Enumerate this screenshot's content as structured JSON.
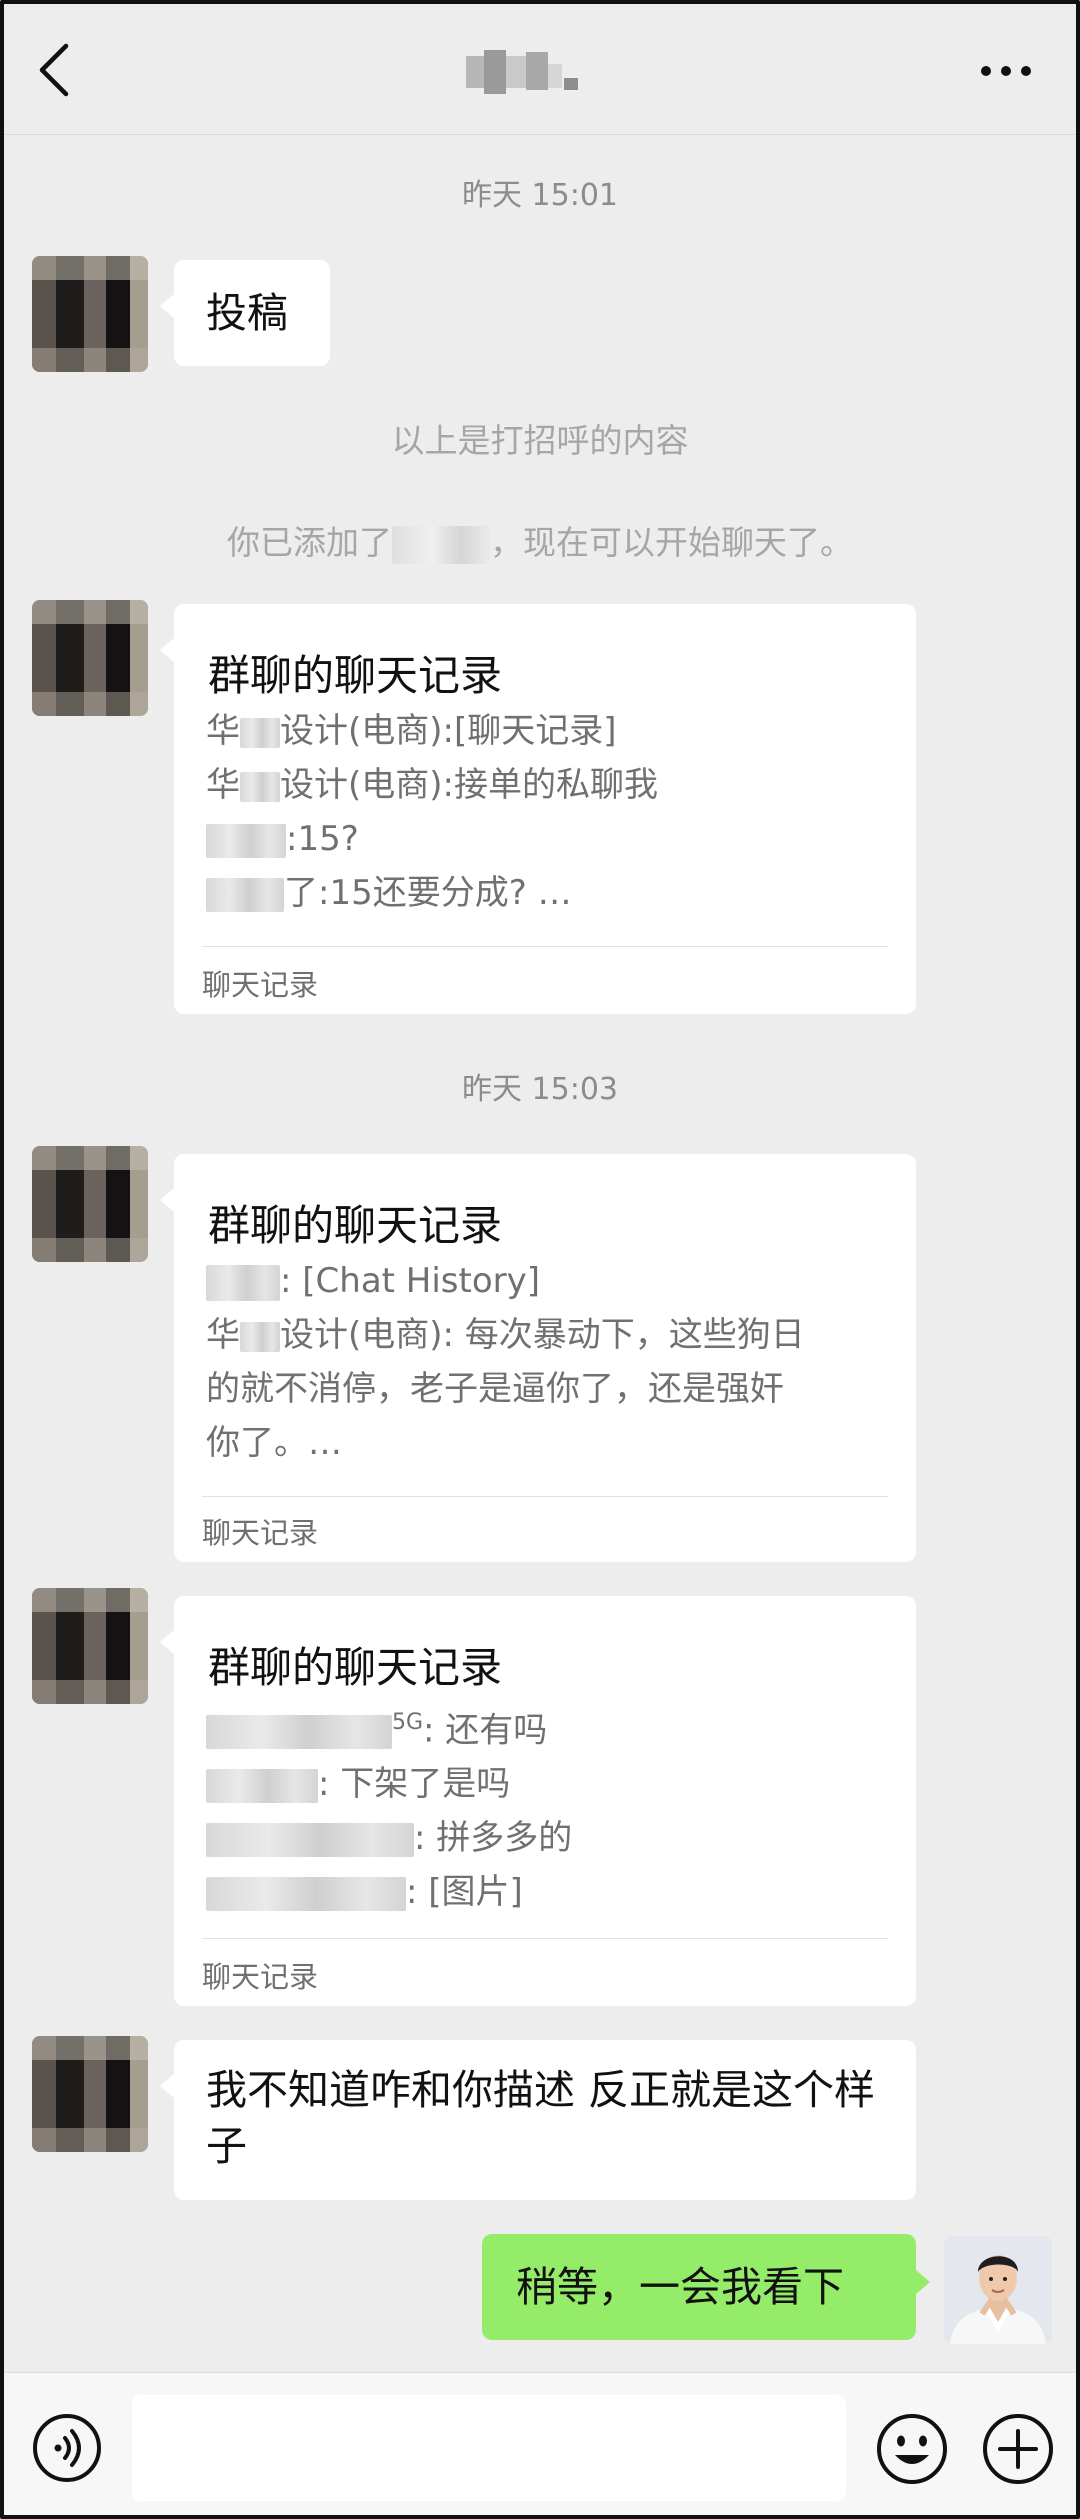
{
  "header": {
    "back_icon": "chevron-left-icon",
    "title": "",
    "more_icon": "more-horizontal-icon"
  },
  "timestamps": [
    "昨天 15:01",
    "昨天 15:03"
  ],
  "system": {
    "greeting_note": "以上是打招呼的内容",
    "added_prefix": "你已添加了",
    "added_suffix": "，现在可以开始聊天了。"
  },
  "messages": {
    "m1_text": "投稿",
    "record1": {
      "title": "群聊的聊天记录",
      "lines": [
        {
          "prefix": "华",
          "text": "设计(电商):[聊天记录]"
        },
        {
          "prefix": "华",
          "text": "设计(电商):接单的私聊我"
        },
        {
          "prefix": "",
          "text": ":15?"
        },
        {
          "prefix": "",
          "text": "了:15还要分成? …"
        }
      ],
      "label": "聊天记录"
    },
    "record2": {
      "title": "群聊的聊天记录",
      "lines": [
        {
          "prefix": "",
          "text": ": [Chat History]"
        },
        {
          "prefix": "华",
          "text": "设计(电商): 每次暴动下，这些狗日"
        },
        {
          "prefix": "",
          "text": "的就不消停，老子是逼你了，还是强奸"
        },
        {
          "prefix": "",
          "text": "你了。…"
        }
      ],
      "label": "聊天记录"
    },
    "record3": {
      "title": "群聊的聊天记录",
      "lines": [
        {
          "sup": "5G",
          "text": ": 还有吗"
        },
        {
          "sup": "",
          "text": ": 下架了是吗"
        },
        {
          "sup": "",
          "text": ": 拼多多的"
        },
        {
          "sup": "",
          "text": ": [图片]"
        }
      ],
      "label": "聊天记录"
    },
    "m5_text": "我不知道咋和你描述 反正就是这个样子",
    "my_text": "稍等，一会我看下"
  },
  "bottom_bar": {
    "voice_icon": "voice-icon",
    "emoji_icon": "emoji-icon",
    "plus_icon": "plus-circle-icon"
  },
  "colors": {
    "background": "#ededed",
    "bubble_mine": "#95ec69",
    "bubble_other": "#ffffff"
  }
}
